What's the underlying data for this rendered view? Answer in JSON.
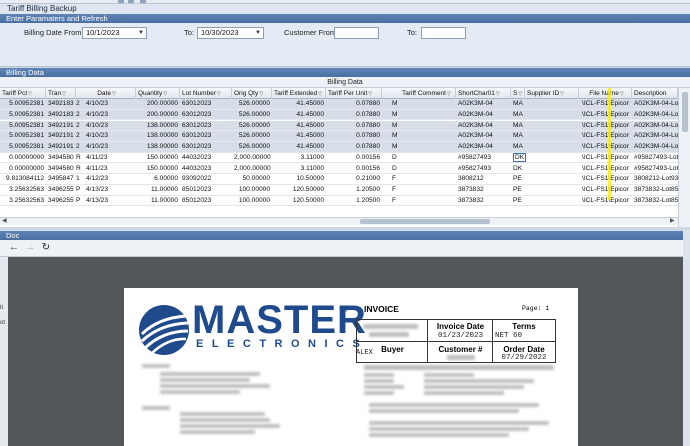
{
  "app": {
    "title": "Tariff Billing Backup"
  },
  "params_section": {
    "title": "Enter Paramaters and Refresh",
    "billing_date_from_label": "Billing Date From:",
    "billing_date_from_value": "10/1/2023",
    "to_label_1": "To:",
    "billing_date_to_value": "10/30/2023",
    "customer_from_label": "Customer From",
    "customer_from_value": "",
    "to_label_2": "To:",
    "customer_to_value": ""
  },
  "billing_section": {
    "title": "Billing Data",
    "banner": "Billing Data",
    "columns": [
      "Tariff Pct",
      "Tran",
      "Date",
      "Quantity",
      "Lot Number",
      "Orig Qty",
      "Tariff Extended",
      "Tariff Per Unit",
      "Tariff Comment",
      "ShortChar01",
      "S",
      "Supplier ID",
      "File Name",
      "Description"
    ],
    "rows": [
      [
        "5.00952381",
        "3492183",
        "2",
        "4/10/23",
        "200.00000",
        "63012023",
        "526.00000",
        "41.45000",
        "0.07880",
        "M",
        "A02K3M-04",
        "MA",
        "",
        "\\ICL-FS1\\Epicor",
        "A02K3M-04-Lot"
      ],
      [
        "5.00952381",
        "3492183",
        "2",
        "4/10/23",
        "200.00000",
        "63012023",
        "526.00000",
        "41.45000",
        "0.07880",
        "M",
        "A02K3M-04",
        "MA",
        "",
        "\\ICL-FS1\\Epicor",
        "A02K3M-04-Lot"
      ],
      [
        "5.00952381",
        "3492191",
        "2",
        "4/10/23",
        "138.00000",
        "63012023",
        "526.00000",
        "41.45000",
        "0.07880",
        "M",
        "A02K3M-04",
        "MA",
        "",
        "\\ICL-FS1\\Epicor",
        "A02K3M-04-Lot"
      ],
      [
        "5.00952381",
        "3492191",
        "2",
        "4/10/23",
        "138.00000",
        "63012023",
        "526.00000",
        "41.45000",
        "0.07880",
        "M",
        "A02K3M-04",
        "MA",
        "",
        "\\ICL-FS1\\Epicor",
        "A02K3M-04-Lot"
      ],
      [
        "5.00952381",
        "3492191",
        "2",
        "4/10/23",
        "138.00000",
        "63012023",
        "526.00000",
        "41.45000",
        "0.07880",
        "M",
        "A02K3M-04",
        "MA",
        "",
        "\\ICL-FS1\\Epicor",
        "A02K3M-04-Lot"
      ],
      [
        "0.00000000",
        "3494580",
        "R",
        "4/11/23",
        "150.00000",
        "44032023",
        "2,000.00000",
        "3.11000",
        "0.00156",
        "D",
        "#95827493",
        "DK",
        "",
        "\\ICL-FS1\\Epicor",
        "#95827493-Lot"
      ],
      [
        "0.00000000",
        "3494580",
        "R",
        "4/11/23",
        "150.00000",
        "44032023",
        "2,000.00000",
        "3.11000",
        "0.00156",
        "D",
        "#95827493",
        "DK",
        "",
        "\\ICL-FS1\\Epicor",
        "#95827493-Lot"
      ],
      [
        "9.813084112",
        "3495847",
        "1",
        "4/12/23",
        "6.00000",
        "93092022",
        "50.00000",
        "10.50000",
        "0.21000",
        "F",
        "3808212",
        "PE",
        "",
        "\\ICL-FS1\\Epicor",
        "3808212-Lot93"
      ],
      [
        "3.25632563",
        "3496255",
        "P",
        "4/13/23",
        "11.00000",
        "85012023",
        "100.00000",
        "120.50000",
        "1.20500",
        "F",
        "3873832",
        "PE",
        "",
        "\\ICL-FS1\\Epicor",
        "3873832-Lot85"
      ],
      [
        "3.25632563",
        "3496255",
        "P",
        "4/13/23",
        "11.00000",
        "85012023",
        "100.00000",
        "120.50000",
        "1.20500",
        "F",
        "3873832",
        "PE",
        "",
        "\\ICL-FS1\\Epicor",
        "3873832-Lot85"
      ]
    ]
  },
  "doc_section": {
    "title": "Doc",
    "back_icon": "arrow-left-icon",
    "forward_icon": "arrow-right-icon",
    "refresh_icon": "refresh-icon"
  },
  "invoice": {
    "logo_text": "MASTER",
    "logo_sub": "ELECTRONICS",
    "logo_tm": "TM",
    "title": "INVOICE",
    "page_label": "Page: 1",
    "invoice_date_label": "Invoice Date",
    "invoice_date_value": "01/23/2023",
    "terms_label": "Terms",
    "terms_value": "NET 60",
    "buyer_label": "Buyer",
    "customer_no_label": "Customer #",
    "order_date_label": "Order Date",
    "order_date_value": "07/29/2022",
    "buyer_value": "ALEX"
  },
  "colors": {
    "section_header": "#4a6fa2",
    "logo_blue": "#1f4a8c",
    "selected_row": "#d7dee8",
    "highlight": "#ffec00"
  }
}
